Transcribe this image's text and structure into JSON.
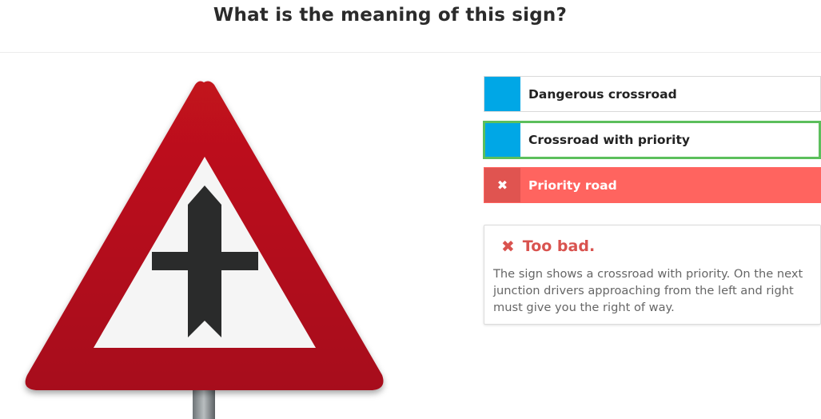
{
  "header": {
    "title": "What is the meaning of this sign?"
  },
  "sign": {
    "icon": "crossroad-with-priority-sign",
    "border_color": "#b8101f",
    "inner_color": "#f5f5f5",
    "symbol_color": "#2a2b2b"
  },
  "answers": [
    {
      "label": "Dangerous crossroad",
      "state": "neutral"
    },
    {
      "label": "Crossroad with priority",
      "state": "correct"
    },
    {
      "label": "Priority road",
      "state": "selected-wrong",
      "icon": "close-icon"
    }
  ],
  "feedback": {
    "icon": "close-icon",
    "title": "Too bad.",
    "text": "The sign shows a crossroad with priority. On the next junction drivers approaching from the left and right must give you the right of way."
  },
  "colors": {
    "accent_blue": "#00a7e6",
    "correct_green": "#5cbf5c",
    "wrong_red": "#ff645f",
    "feedback_red": "#d9534f"
  }
}
